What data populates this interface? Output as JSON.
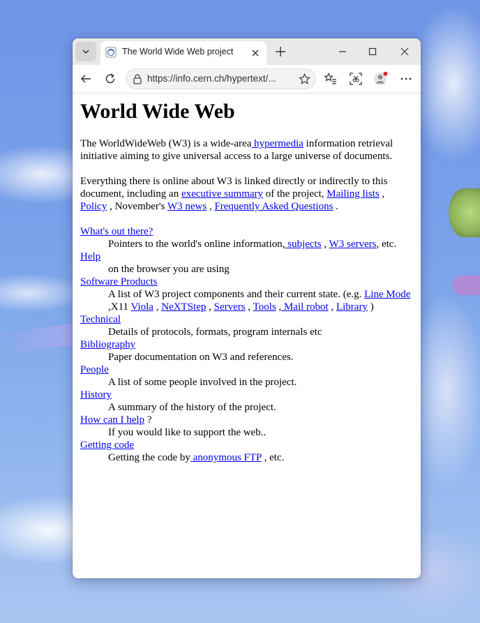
{
  "tab": {
    "title": "The World Wide Web project"
  },
  "address": {
    "url": "https://info.cern.ch/hypertext/..."
  },
  "page": {
    "heading": "World Wide Web",
    "intro": {
      "t1": "The WorldWideWeb (W3) is a wide-area",
      "link_hypermedia": " hypermedia",
      "t2": " information retrieval initiative aiming to give universal access to a large universe of documents."
    },
    "para2": {
      "t1": "Everything there is online about W3 is linked directly or indirectly to this document, including an ",
      "link_exec": "executive summary",
      "t2": " of the project, ",
      "link_mailing": "Mailing lists",
      "t3": " , ",
      "link_policy": "Policy",
      "t4": " , November's ",
      "link_news": "W3 news",
      "t5": " , ",
      "link_faq": "Frequently Asked Questions",
      "t6": " ."
    },
    "items": [
      {
        "term": "What's out there?",
        "desc_parts": [
          "Pointers to the world's online information,",
          " subjects",
          " , ",
          "W3 servers",
          ", etc."
        ]
      },
      {
        "term": "Help",
        "desc": "on the browser you are using"
      },
      {
        "term": "Software Products",
        "desc_parts": [
          "A list of W3 project components and their current state. (e.g. ",
          "Line Mode",
          " ,X11 ",
          "Viola",
          " , ",
          "NeXTStep",
          " , ",
          "Servers",
          " , ",
          "Tools",
          " ,",
          " Mail robot",
          " , ",
          "Library",
          " )"
        ]
      },
      {
        "term": "Technical",
        "desc": "Details of protocols, formats, program internals etc"
      },
      {
        "term": "Bibliography",
        "desc": "Paper documentation on W3 and references."
      },
      {
        "term": "People",
        "desc": "A list of some people involved in the project."
      },
      {
        "term": "History",
        "desc": "A summary of the history of the project."
      },
      {
        "term": "How can I help",
        "term_suffix": " ?",
        "desc": "If you would like to support the web.."
      },
      {
        "term": "Getting code",
        "desc_parts": [
          "Getting the code by",
          " anonymous FTP",
          " , etc."
        ]
      }
    ]
  },
  "colors": {
    "link": "#0000ee",
    "titlebar": "#e9e9e9",
    "notification_dot": "#e0262b"
  }
}
